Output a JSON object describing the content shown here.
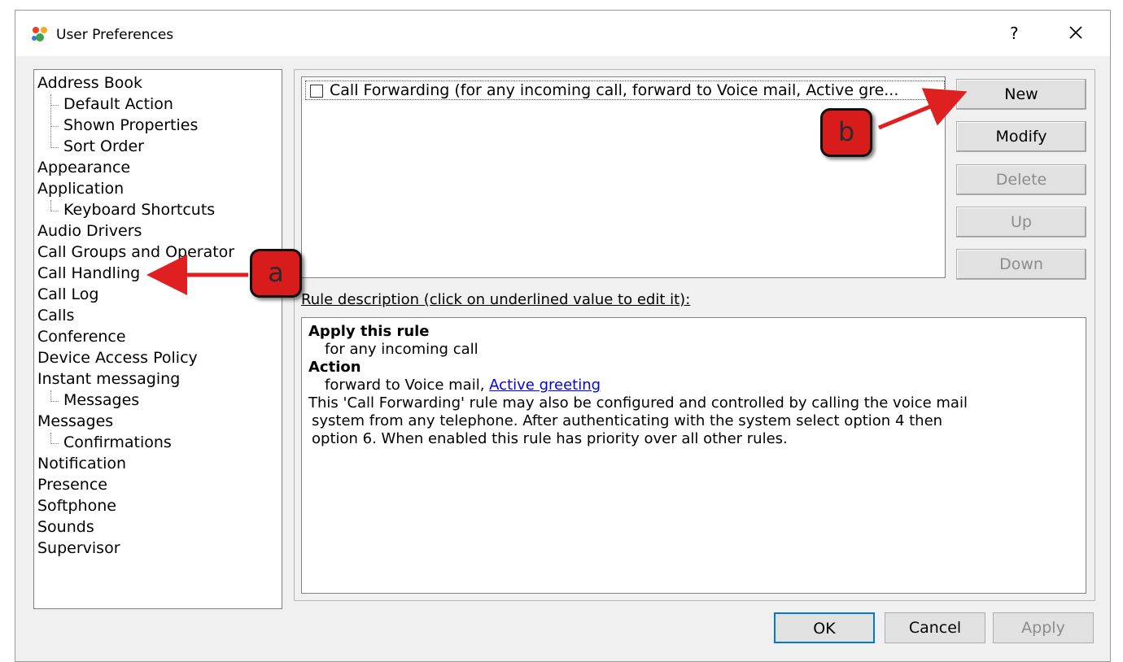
{
  "window": {
    "title": "User Preferences",
    "help_label": "?"
  },
  "tree": {
    "items": [
      {
        "label": "Address Book",
        "level": 0
      },
      {
        "label": "Default Action",
        "level": 1
      },
      {
        "label": "Shown Properties",
        "level": 1
      },
      {
        "label": "Sort Order",
        "level": 1
      },
      {
        "label": "Appearance",
        "level": 0
      },
      {
        "label": "Application",
        "level": 0
      },
      {
        "label": "Keyboard Shortcuts",
        "level": 1
      },
      {
        "label": "Audio Drivers",
        "level": 0
      },
      {
        "label": "Call Groups and Operator",
        "level": 0
      },
      {
        "label": "Call Handling",
        "level": 0
      },
      {
        "label": "Call Log",
        "level": 0
      },
      {
        "label": "Calls",
        "level": 0
      },
      {
        "label": "Conference",
        "level": 0
      },
      {
        "label": "Device Access Policy",
        "level": 0
      },
      {
        "label": "Instant messaging",
        "level": 0
      },
      {
        "label": "Messages",
        "level": 1
      },
      {
        "label": "Messages",
        "level": 0
      },
      {
        "label": "Confirmations",
        "level": 1
      },
      {
        "label": "Notification",
        "level": 0
      },
      {
        "label": "Presence",
        "level": 0
      },
      {
        "label": "Softphone",
        "level": 0
      },
      {
        "label": "Sounds",
        "level": 0
      },
      {
        "label": "Supervisor",
        "level": 0
      }
    ]
  },
  "rules": {
    "items": [
      {
        "label": "Call Forwarding (for any incoming call, forward to Voice mail, Active gre...",
        "checked": false
      }
    ]
  },
  "buttons": {
    "new": "New",
    "modify": "Modify",
    "delete": "Delete",
    "up": "Up",
    "down": "Down"
  },
  "description": {
    "label": "Rule description (click on underlined value to edit it):",
    "apply_heading": "Apply this rule",
    "apply_text": "for any incoming call",
    "action_heading": "Action",
    "action_text": "forward to Voice mail, ",
    "action_link": "Active greeting",
    "note_line1": "This 'Call Forwarding' rule may also be configured and controlled by calling the voice mail",
    "note_line2": "system from any telephone. After authenticating with the system select option 4 then",
    "note_line3": "option 6. When enabled this rule has priority over all other rules."
  },
  "footer": {
    "ok": "OK",
    "cancel": "Cancel",
    "apply": "Apply"
  },
  "callouts": {
    "a": "a",
    "b": "b"
  },
  "colors": {
    "callout_red": "#d81c1c",
    "arrow_red": "#e02020",
    "link_blue": "#0000ee"
  }
}
